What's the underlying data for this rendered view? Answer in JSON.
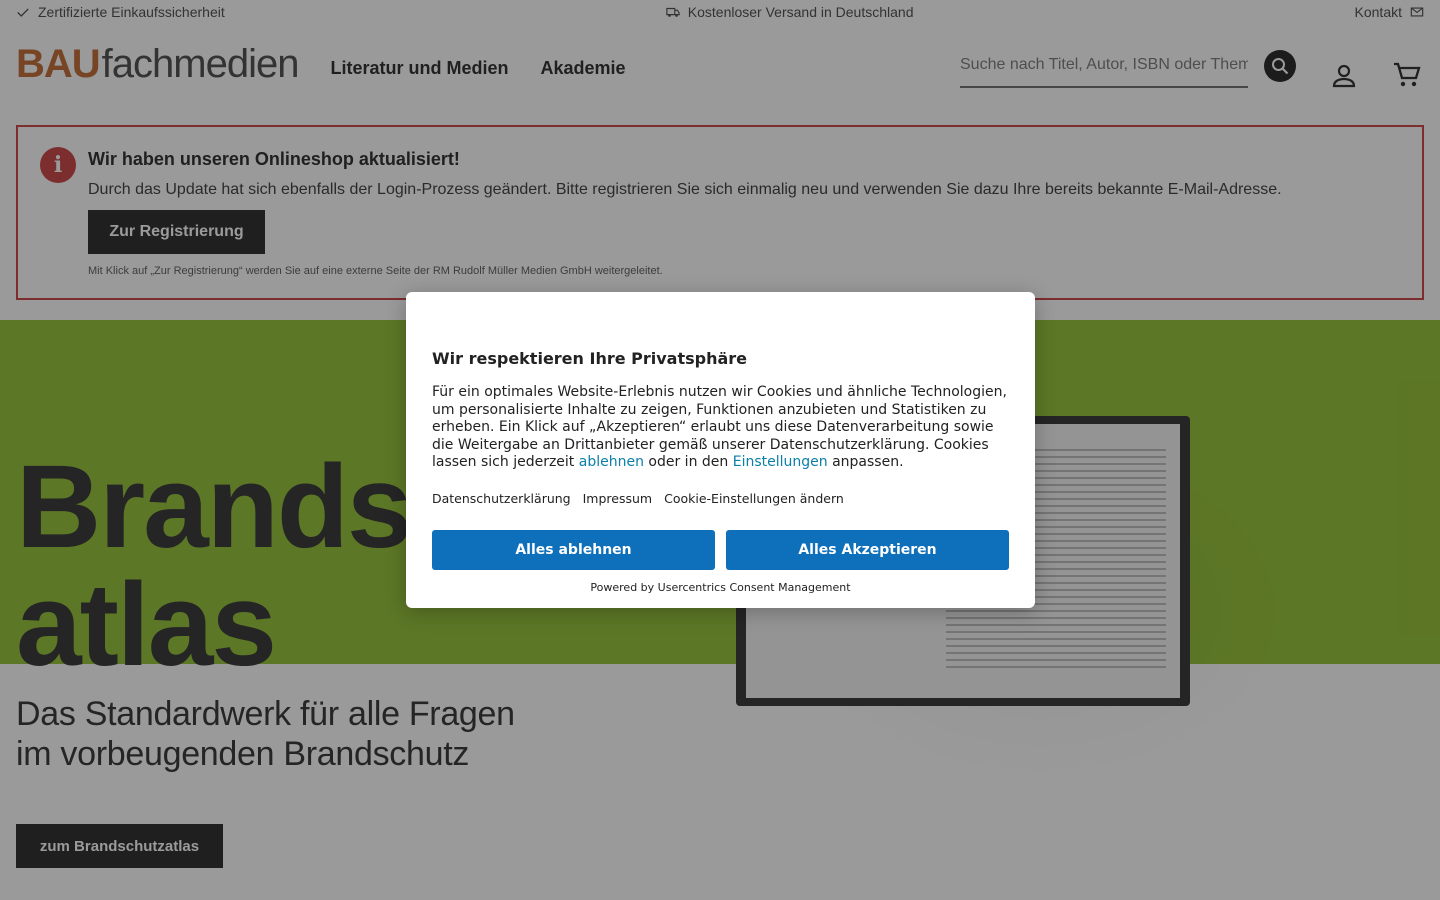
{
  "topbar": {
    "left": "Zertifizierte Einkaufssicherheit",
    "center": "Kostenloser Versand in Deutschland",
    "right": "Kontakt"
  },
  "header": {
    "logo_bau": "BAU",
    "logo_fach": "fachmedien",
    "nav": [
      "Literatur und Medien",
      "Akademie"
    ],
    "search_placeholder": "Suche nach Titel, Autor, ISBN oder Thema..."
  },
  "notice": {
    "icon": "i",
    "title": "Wir haben unseren Onlineshop aktualisiert!",
    "text": "Durch das Update hat sich ebenfalls der Login-Prozess geändert. Bitte registrieren Sie sich einmalig neu und verwenden Sie dazu Ihre bereits bekannte E-Mail-Adresse.",
    "button": "Zur Registrierung",
    "small": "Mit Klick auf „Zur Registrierung“ werden Sie auf eine externe Seite der RM Rudolf Müller Medien GmbH weitergeleitet."
  },
  "hero": {
    "title_line1": "Brandsc",
    "title_line2": "atlas",
    "sub_line1": "Das Standardwerk für alle Fragen",
    "sub_line2": "im vorbeugenden Brandschutz",
    "button": "zum Brandschutzatlas",
    "bg_color": "#8fbf2d"
  },
  "consent": {
    "title": "Wir respektieren Ihre Privatsphäre",
    "body_pre": "Für ein optimales Website-Erlebnis nutzen wir Cookies und ähnliche Technologien, um personalisierte Inhalte zu zeigen, Funktionen anzubieten und Statistiken zu erheben. Ein Klick auf „Akzeptieren“ erlaubt uns diese Datenverarbeitung sowie die Weitergabe an Drittanbieter gemäß unserer Datenschutzerklärung. Cookies lassen sich jederzeit ",
    "link_deny": "ablehnen",
    "body_mid": " oder in den ",
    "link_settings": "Einstellungen",
    "body_post": " anpassen.",
    "links": [
      "Datenschutzerklärung",
      "Impressum",
      "Cookie-Einstellungen ändern"
    ],
    "deny_button": "Alles ablehnen",
    "accept_button": "Alles Akzeptieren",
    "powered": "Powered by Usercentrics Consent Management",
    "button_color": "#0e6fbb"
  }
}
